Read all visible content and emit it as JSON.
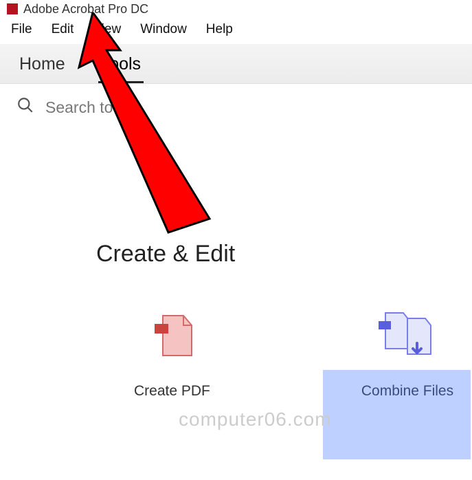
{
  "titlebar": {
    "app_name": "Adobe Acrobat Pro DC"
  },
  "menubar": {
    "items": [
      "File",
      "Edit",
      "View",
      "Window",
      "Help"
    ]
  },
  "tabs": {
    "items": [
      "Home",
      "Tools"
    ],
    "active_index": 1
  },
  "search": {
    "placeholder": "Search tools"
  },
  "main": {
    "section_heading": "Create & Edit",
    "tools": [
      {
        "label": "Create PDF"
      },
      {
        "label": "Combine Files"
      }
    ]
  },
  "watermark": "computer06.com"
}
